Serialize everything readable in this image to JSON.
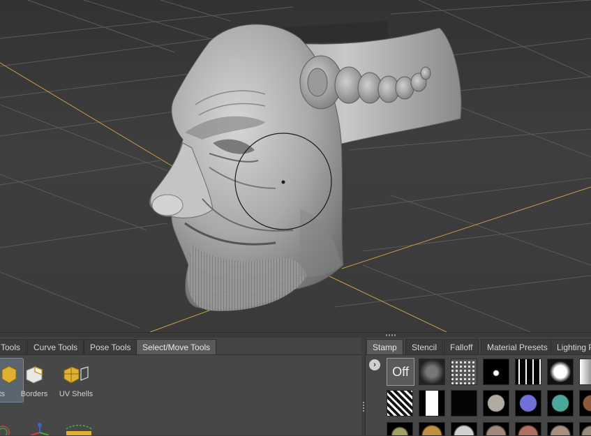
{
  "left_panel": {
    "tabs": [
      {
        "label": "Tools",
        "active": false
      },
      {
        "label": "Curve Tools",
        "active": false
      },
      {
        "label": "Pose Tools",
        "active": false
      },
      {
        "label": "Select/Move Tools",
        "active": true
      }
    ],
    "tools": [
      {
        "label": "cts",
        "icon": "objects-icon",
        "selected": true
      },
      {
        "label": "Borders",
        "icon": "borders-icon"
      },
      {
        "label": "UV Shells",
        "icon": "uv-shells-icon"
      }
    ]
  },
  "right_panel": {
    "tabs": [
      {
        "label": "Stamp",
        "active": true
      },
      {
        "label": "Stencil",
        "active": false
      },
      {
        "label": "Falloff",
        "active": false
      },
      {
        "label": "Material Presets",
        "active": false
      },
      {
        "label": "Lighting Pr",
        "active": false
      }
    ],
    "off_label": "Off",
    "stamps": [
      "noise-stamp-icon",
      "grid-stamp-icon",
      "splatter-stamp-icon",
      "streaks-stamp-icon",
      "cloud-stamp-icon",
      "soft-stamp-icon",
      "pattern-stamp-icon",
      "bar-stamp-icon",
      "dark-stamp-icon",
      "rock-sphere-icon",
      "blue-bumps-sphere-icon",
      "teal-sphere-icon",
      "brown-stamp-icon"
    ]
  },
  "colors": {
    "grid_axis": "#c8a04a",
    "active_tab": "#5a5a5a",
    "panel_bg": "#474747"
  }
}
